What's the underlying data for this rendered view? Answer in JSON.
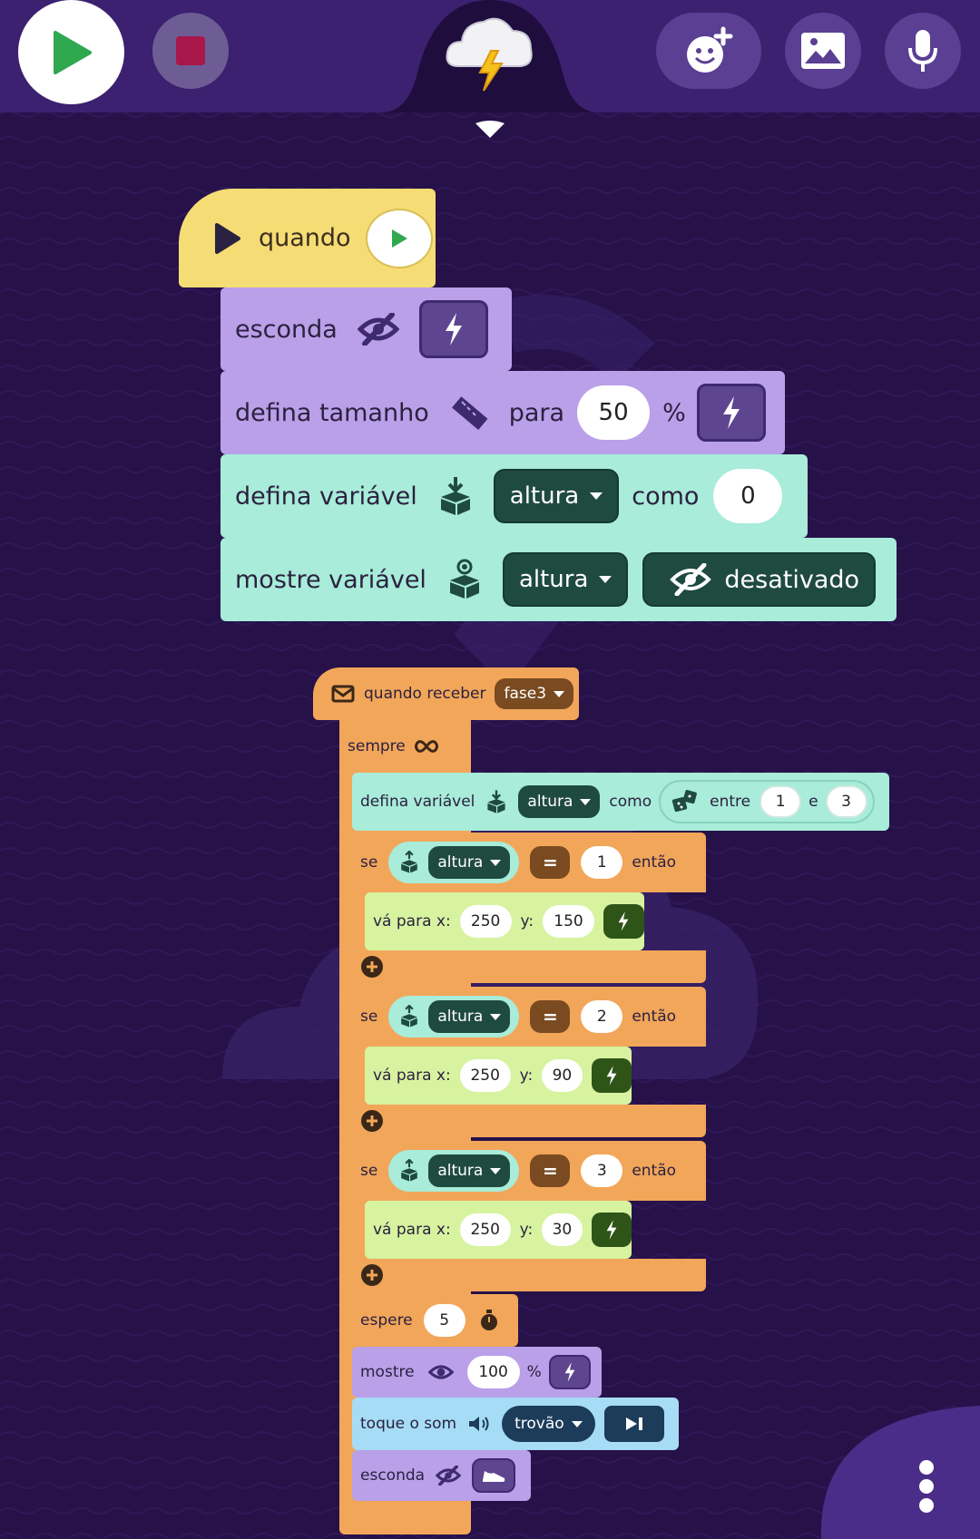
{
  "toolbar": {
    "play_color": "#2fa84f",
    "stop_color": "#a8174a"
  },
  "colors": {
    "background": "#261149",
    "event_yellow": "#f6dc74",
    "looks_purple": "#b9a0e8",
    "variable_teal": "#a8ecd9",
    "control_orange": "#f2a65a",
    "motion_green": "#d7f3a0",
    "sound_blue": "#a6dcf5"
  },
  "script1": {
    "hat_label": "quando",
    "hide_label": "esconda",
    "size_label": "defina tamanho",
    "size_to": "para",
    "size_value": "50",
    "size_unit": "%",
    "setvar_label": "defina variável",
    "setvar_var": "altura",
    "setvar_as": "como",
    "setvar_value": "0",
    "showvar_label": "mostre variável",
    "showvar_var": "altura",
    "showvar_state": "desativado"
  },
  "script2": {
    "hat_label": "quando receber",
    "hat_message": "fase3",
    "forever_label": "sempre",
    "setvar_label": "defina variável",
    "setvar_var": "altura",
    "setvar_as": "como",
    "random_between": "entre",
    "random_min": "1",
    "random_and": "e",
    "random_max": "3",
    "ifs": [
      {
        "if": "se",
        "var": "altura",
        "op": "=",
        "value": "1",
        "then": "então",
        "goto": "vá para x:",
        "x": "250",
        "ylabel": "y:",
        "y": "150"
      },
      {
        "if": "se",
        "var": "altura",
        "op": "=",
        "value": "2",
        "then": "então",
        "goto": "vá para x:",
        "x": "250",
        "ylabel": "y:",
        "y": "90"
      },
      {
        "if": "se",
        "var": "altura",
        "op": "=",
        "value": "3",
        "then": "então",
        "goto": "vá para x:",
        "x": "250",
        "ylabel": "y:",
        "y": "30"
      }
    ],
    "wait_label": "espere",
    "wait_value": "5",
    "show_label": "mostre",
    "show_value": "100",
    "show_unit": "%",
    "sound_label": "toque o som",
    "sound_name": "trovão",
    "hide_label": "esconda"
  }
}
